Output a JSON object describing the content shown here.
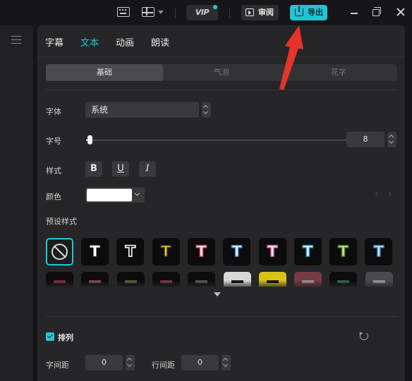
{
  "topbar": {
    "vip_label": "VIP",
    "review_label": "审阅",
    "export_label": "导出"
  },
  "tabs": [
    {
      "label": "字幕"
    },
    {
      "label": "文本",
      "active": true
    },
    {
      "label": "动画"
    },
    {
      "label": "朗读"
    }
  ],
  "segment": [
    {
      "label": "基础",
      "active": true
    },
    {
      "label": "气泡"
    },
    {
      "label": "花字"
    }
  ],
  "font": {
    "label": "字体",
    "value": "系统"
  },
  "size": {
    "label": "字号",
    "value": "8"
  },
  "style": {
    "label": "样式",
    "bold": "B",
    "underline": "U",
    "italic": "I"
  },
  "color": {
    "label": "颜色",
    "value": "#ffffff"
  },
  "presets": {
    "label": "预设样式",
    "glyph": "T",
    "row1": [
      {
        "fill": "#ffffff",
        "stroke": "none"
      },
      {
        "fill": "#0c0c0d",
        "stroke": "#ffffff"
      },
      {
        "fill": "#ffd21e",
        "stroke": "#333"
      },
      {
        "fill": "#ffffff",
        "stroke": "#e0506a"
      },
      {
        "fill": "#ffffff",
        "stroke": "#4d8fd6"
      },
      {
        "fill": "#ffffff",
        "stroke": "#ef5aa6"
      },
      {
        "fill": "#ffffff",
        "stroke": "#27a2e8"
      },
      {
        "fill": "#e7e97a",
        "stroke": "#3f8a2a"
      },
      {
        "fill": "#d9e6f2",
        "stroke": "#3d86c6"
      }
    ],
    "row2": [
      {
        "bg": "#0c0c0d",
        "bar": "#8a2a3a"
      },
      {
        "bg": "#0c0c0d",
        "bar": "#8a4a42"
      },
      {
        "bg": "#0c0c0d",
        "bar": "#6a5a3a"
      },
      {
        "bg": "#0c0c0d",
        "bar": "#7a3a42"
      },
      {
        "bg": "#0c0c0d",
        "bar": "#5a5a5a"
      },
      {
        "bg": "#d8d8d8",
        "bar": "#111111"
      },
      {
        "bg": "#d8c418",
        "bar": "#111111"
      },
      {
        "bg": "#7a3a44",
        "bar": "#9a9a9a"
      },
      {
        "bg": "#0c0c0d",
        "bar": "#2a6a4a"
      },
      {
        "bg": "#4a4a4c",
        "bar": "#9aa0a6"
      }
    ]
  },
  "arrange": {
    "label": "排列",
    "checked": true
  },
  "letter_spacing": {
    "label": "字间距",
    "value": "0"
  },
  "line_spacing": {
    "label": "行间距",
    "value": "0"
  },
  "colors": {
    "accent": "#22c8d6",
    "panel": "#262628",
    "annotation": "#e8322a"
  }
}
